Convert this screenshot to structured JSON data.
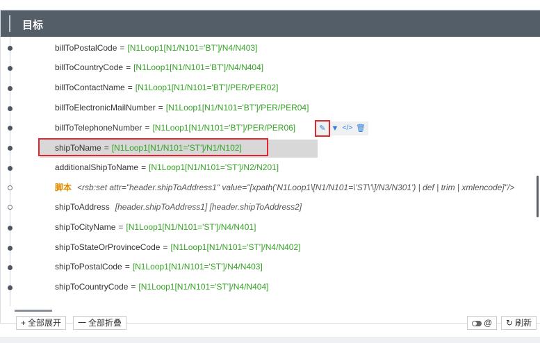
{
  "header": {
    "title": "目标"
  },
  "rows": [
    {
      "name": "billToPostalCode",
      "eq": "=",
      "expr": "[N1Loop1[N1/N101='BT']/N4/N403]"
    },
    {
      "name": "billToCountryCode",
      "eq": "=",
      "expr": "[N1Loop1[N1/N101='BT']/N4/N404]"
    },
    {
      "name": "billToContactName",
      "eq": "=",
      "expr": "[N1Loop1[N1/N101='BT']/PER/PER02]"
    },
    {
      "name": "billToElectronicMailNumber",
      "eq": "=",
      "expr": "[N1Loop1[N1/N101='BT']/PER/PER04]"
    },
    {
      "name": "billToTelephoneNumber",
      "eq": "=",
      "expr": "[N1Loop1[N1/N101='BT']/PER/PER06]"
    },
    {
      "name": "shipToName",
      "eq": "=",
      "expr": "[N1Loop1[N1/N101='ST']/N1/N102]"
    },
    {
      "name": "additionalShipToName",
      "eq": "=",
      "expr": "[N1Loop1[N1/N101='ST']/N2/N201]"
    },
    {
      "keyword": "脚本",
      "script": "<rsb:set attr=\"header.shipToAddress1\" value=\"[xpath('N1Loop1\\[N1/N101=\\'ST\\'\\]/N3/N301') | def | trim | xmlencode]\"/>"
    },
    {
      "name": "shipToAddress",
      "addr": "[header.shipToAddress1] [header.shipToAddress2]"
    },
    {
      "name": "shipToCityName",
      "eq": "=",
      "expr": "[N1Loop1[N1/N101='ST']/N4/N401]"
    },
    {
      "name": "shipToStateOrProvinceCode",
      "eq": "=",
      "expr": "[N1Loop1[N1/N101='ST']/N4/N402]"
    },
    {
      "name": "shipToPostalCode",
      "eq": "=",
      "expr": "[N1Loop1[N1/N101='ST']/N4/N403]"
    },
    {
      "name": "shipToCountryCode",
      "eq": "=",
      "expr": "[N1Loop1[N1/N101='ST']/N4/N404]"
    }
  ],
  "row_tools": {
    "icons": [
      "edit-icon",
      "filter-icon",
      "code-icon",
      "delete-icon"
    ],
    "glyphs": {
      "edit": "✎",
      "filter": "▼",
      "code": "</>",
      "delete": "🗑"
    }
  },
  "footer": {
    "expand_all": "全部展开",
    "expand_icon": "+",
    "collapse_all": "全部折叠",
    "collapse_icon": "一",
    "toggle_at": "@",
    "refresh": "刷新",
    "refresh_icon": "↻"
  },
  "colors": {
    "header_bg": "#545e69",
    "expression_green": "#35a326",
    "keyword_orange": "#e08a00",
    "highlight_box": "#e0262e",
    "icon_blue": "#2d7fd3"
  }
}
